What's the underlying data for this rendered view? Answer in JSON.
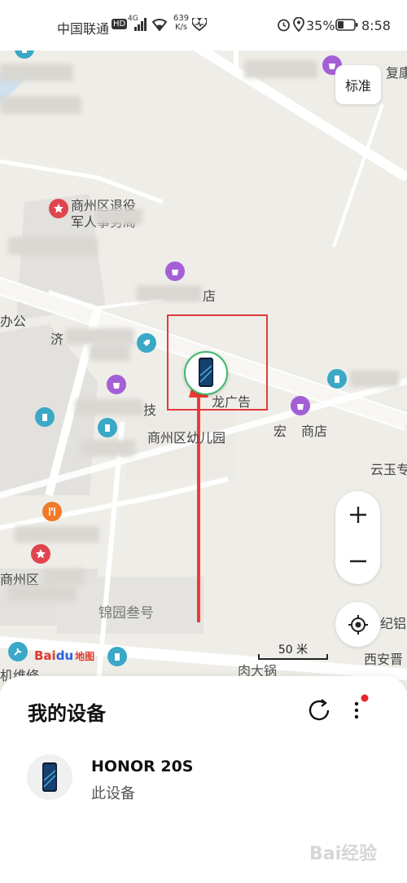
{
  "status_bar": {
    "carrier": "中国联通",
    "network_badge": "HD",
    "network_type": "4G",
    "speed_value": "639",
    "speed_unit": "K/s",
    "battery_percent": "35%",
    "time": "8:58",
    "icons": [
      "hd-icon",
      "signal-icon",
      "wifi-icon",
      "heart-icon",
      "alarm-icon",
      "location-icon",
      "battery-icon"
    ]
  },
  "map": {
    "map_style_button": "标准",
    "zoom_in": "+",
    "zoom_out": "−",
    "scale_label": "50 米",
    "logo_text_bai": "Bai",
    "logo_text_du": "du",
    "logo_text_map": "地图",
    "pois": [
      "复康",
      "商州区退役",
      "军人事务局",
      "办公",
      "济",
      "店",
      "龙广告",
      "技",
      "商州区幼儿园",
      "宏",
      "商店",
      "云玉专",
      "纪铝",
      "锦园叁号",
      "西安晋",
      "机维修",
      "肉大锅",
      "商州区",
      "公"
    ]
  },
  "sheet": {
    "title": "我的设备",
    "device": {
      "name": "HONOR 20S",
      "subtitle": "此设备"
    }
  },
  "watermark": "Bai经验",
  "colors": {
    "accent_red": "#e23b3b",
    "marker_green": "#3fb86a",
    "poi_purple": "#a45fd6",
    "poi_teal": "#3aa8c6",
    "poi_red": "#e0454f",
    "poi_orange": "#f07a2a"
  }
}
